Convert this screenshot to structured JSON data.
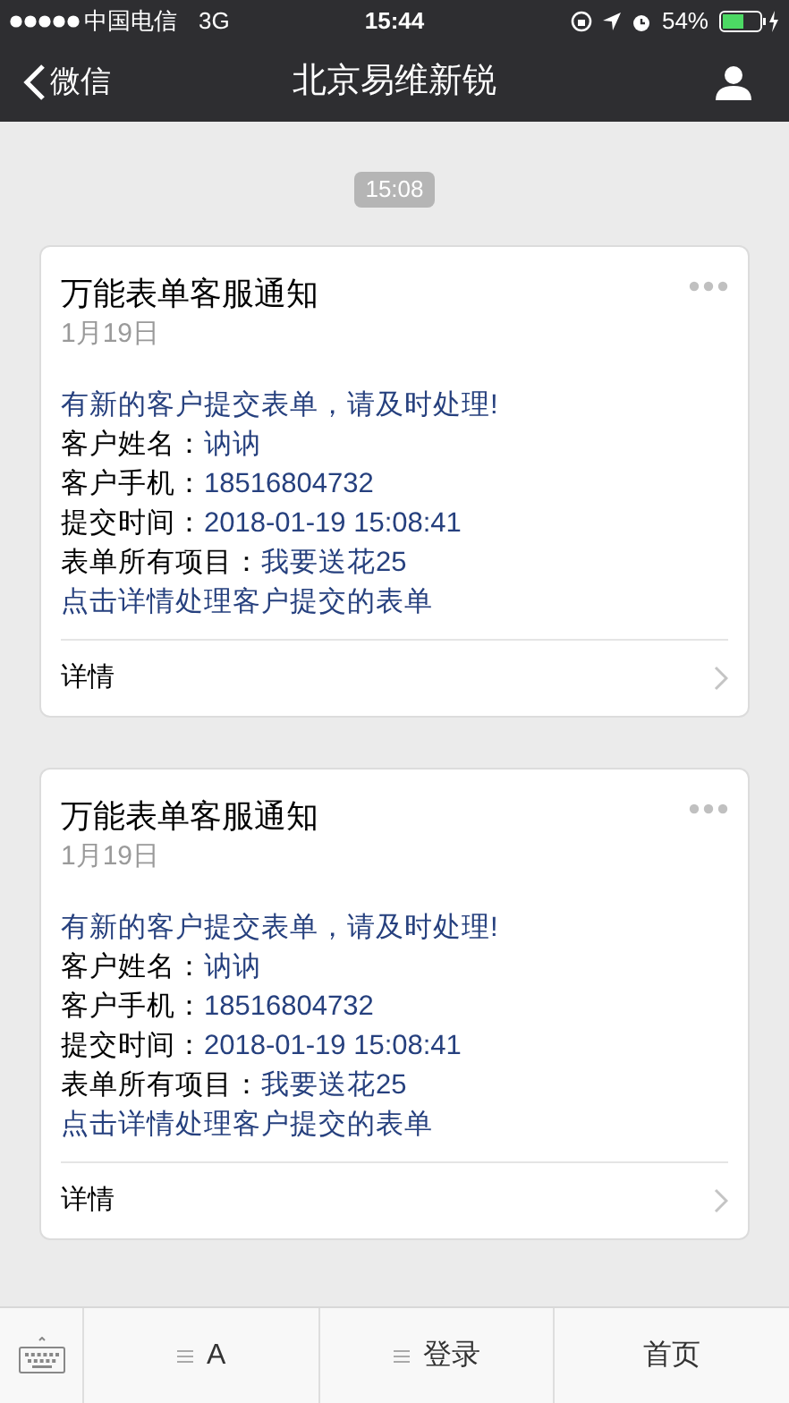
{
  "status_bar": {
    "carrier": "中国电信",
    "network": "3G",
    "time": "15:44",
    "battery": "54%"
  },
  "nav": {
    "back": "微信",
    "title": "北京易维新锐"
  },
  "timestamp": "15:08",
  "messages": [
    {
      "title": "万能表单客服通知",
      "date": "1月19日",
      "lines": [
        {
          "value": "有新的客户提交表单，请及时处理!"
        },
        {
          "label": "客户姓名：",
          "value": "讷讷"
        },
        {
          "label": "客户手机：",
          "value": "18516804732"
        },
        {
          "label": "提交时间：",
          "value": "2018-01-19 15:08:41"
        },
        {
          "label": "表单所有项目：",
          "value": "我要送花25"
        },
        {
          "value": "点击详情处理客户提交的表单"
        }
      ],
      "link": "详情"
    },
    {
      "title": "万能表单客服通知",
      "date": "1月19日",
      "lines": [
        {
          "value": "有新的客户提交表单，请及时处理!"
        },
        {
          "label": "客户姓名：",
          "value": "讷讷"
        },
        {
          "label": "客户手机：",
          "value": "18516804732"
        },
        {
          "label": "提交时间：",
          "value": "2018-01-19 15:08:41"
        },
        {
          "label": "表单所有项目：",
          "value": "我要送花25"
        },
        {
          "value": "点击详情处理客户提交的表单"
        }
      ],
      "link": "详情"
    }
  ],
  "menu": [
    {
      "label": "A",
      "submenu": true
    },
    {
      "label": "登录",
      "submenu": true
    },
    {
      "label": "首页",
      "submenu": false
    }
  ]
}
